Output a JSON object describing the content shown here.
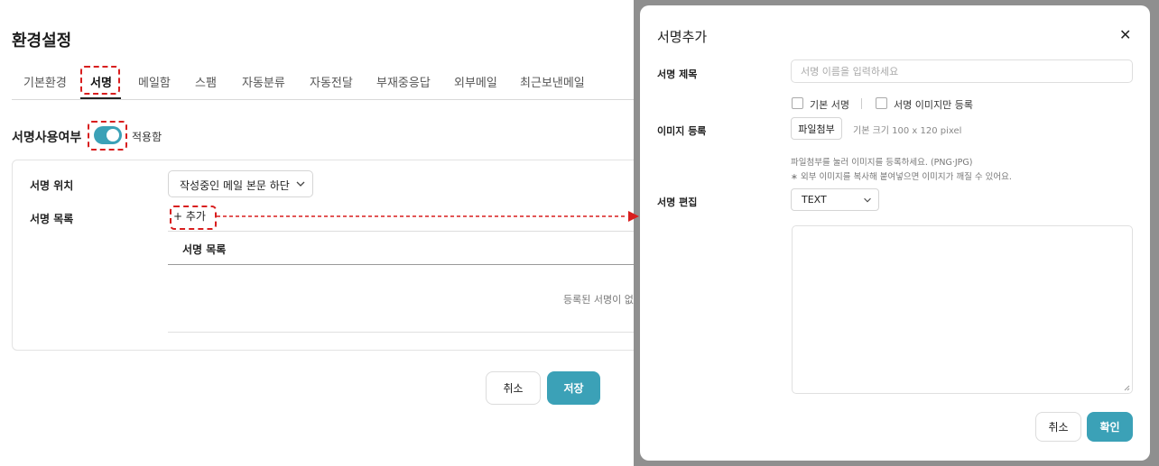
{
  "settings": {
    "title": "환경설정",
    "tabs": [
      {
        "label": "기본환경"
      },
      {
        "label": "서명",
        "active": true
      },
      {
        "label": "메일함"
      },
      {
        "label": "스팸"
      },
      {
        "label": "자동분류"
      },
      {
        "label": "자동전달"
      },
      {
        "label": "부재중응답"
      },
      {
        "label": "외부메일"
      },
      {
        "label": "최근보낸메일"
      }
    ],
    "signature_use": {
      "label": "서명사용여부",
      "toggle_on": true,
      "status_text": "적용함"
    },
    "position": {
      "label": "서명 위치",
      "selected": "작성중인 메일 본문 하단"
    },
    "list": {
      "label": "서명 목록",
      "add_label": "+ 추가",
      "column_header": "서명 목록",
      "empty_text": "등록된 서명이 없"
    },
    "buttons": {
      "cancel": "취소",
      "save": "저장"
    }
  },
  "modal": {
    "title": "서명추가",
    "title_field": {
      "label": "서명 제목",
      "value": "",
      "placeholder": "서명 이름을 입력하세요"
    },
    "options": {
      "default_label": "기본 서명",
      "image_only_label": "서명 이미지만 등록"
    },
    "image": {
      "label": "이미지 등록",
      "attach_label": "파일첨부",
      "size_hint": "기본 크기 100 x 120 pixel",
      "help_line1": "파일첨부를 눌러 이미지를 등록하세요. (PNG·JPG)",
      "help_line2": "∗ 외부 이미지를 복사해 붙여넣으면 이미지가 깨질 수 있어요."
    },
    "edit": {
      "label": "서명 편집",
      "mode": "TEXT"
    },
    "buttons": {
      "cancel": "취소",
      "confirm": "확인"
    }
  },
  "colors": {
    "accent": "#3ba1b7",
    "annotation": "#d81e1e",
    "backdrop": "#8f8f8f"
  }
}
